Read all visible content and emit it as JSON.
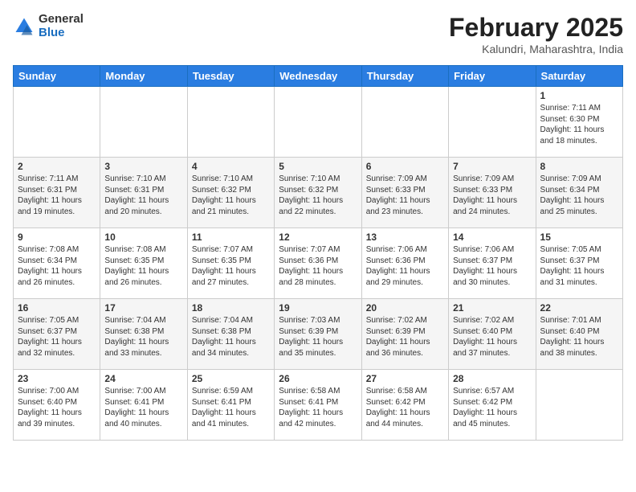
{
  "logo": {
    "general": "General",
    "blue": "Blue"
  },
  "title": "February 2025",
  "subtitle": "Kalundri, Maharashtra, India",
  "days_of_week": [
    "Sunday",
    "Monday",
    "Tuesday",
    "Wednesday",
    "Thursday",
    "Friday",
    "Saturday"
  ],
  "weeks": [
    [
      {
        "day": "",
        "info": ""
      },
      {
        "day": "",
        "info": ""
      },
      {
        "day": "",
        "info": ""
      },
      {
        "day": "",
        "info": ""
      },
      {
        "day": "",
        "info": ""
      },
      {
        "day": "",
        "info": ""
      },
      {
        "day": "1",
        "info": "Sunrise: 7:11 AM\nSunset: 6:30 PM\nDaylight: 11 hours\nand 18 minutes."
      }
    ],
    [
      {
        "day": "2",
        "info": "Sunrise: 7:11 AM\nSunset: 6:31 PM\nDaylight: 11 hours\nand 19 minutes."
      },
      {
        "day": "3",
        "info": "Sunrise: 7:10 AM\nSunset: 6:31 PM\nDaylight: 11 hours\nand 20 minutes."
      },
      {
        "day": "4",
        "info": "Sunrise: 7:10 AM\nSunset: 6:32 PM\nDaylight: 11 hours\nand 21 minutes."
      },
      {
        "day": "5",
        "info": "Sunrise: 7:10 AM\nSunset: 6:32 PM\nDaylight: 11 hours\nand 22 minutes."
      },
      {
        "day": "6",
        "info": "Sunrise: 7:09 AM\nSunset: 6:33 PM\nDaylight: 11 hours\nand 23 minutes."
      },
      {
        "day": "7",
        "info": "Sunrise: 7:09 AM\nSunset: 6:33 PM\nDaylight: 11 hours\nand 24 minutes."
      },
      {
        "day": "8",
        "info": "Sunrise: 7:09 AM\nSunset: 6:34 PM\nDaylight: 11 hours\nand 25 minutes."
      }
    ],
    [
      {
        "day": "9",
        "info": "Sunrise: 7:08 AM\nSunset: 6:34 PM\nDaylight: 11 hours\nand 26 minutes."
      },
      {
        "day": "10",
        "info": "Sunrise: 7:08 AM\nSunset: 6:35 PM\nDaylight: 11 hours\nand 26 minutes."
      },
      {
        "day": "11",
        "info": "Sunrise: 7:07 AM\nSunset: 6:35 PM\nDaylight: 11 hours\nand 27 minutes."
      },
      {
        "day": "12",
        "info": "Sunrise: 7:07 AM\nSunset: 6:36 PM\nDaylight: 11 hours\nand 28 minutes."
      },
      {
        "day": "13",
        "info": "Sunrise: 7:06 AM\nSunset: 6:36 PM\nDaylight: 11 hours\nand 29 minutes."
      },
      {
        "day": "14",
        "info": "Sunrise: 7:06 AM\nSunset: 6:37 PM\nDaylight: 11 hours\nand 30 minutes."
      },
      {
        "day": "15",
        "info": "Sunrise: 7:05 AM\nSunset: 6:37 PM\nDaylight: 11 hours\nand 31 minutes."
      }
    ],
    [
      {
        "day": "16",
        "info": "Sunrise: 7:05 AM\nSunset: 6:37 PM\nDaylight: 11 hours\nand 32 minutes."
      },
      {
        "day": "17",
        "info": "Sunrise: 7:04 AM\nSunset: 6:38 PM\nDaylight: 11 hours\nand 33 minutes."
      },
      {
        "day": "18",
        "info": "Sunrise: 7:04 AM\nSunset: 6:38 PM\nDaylight: 11 hours\nand 34 minutes."
      },
      {
        "day": "19",
        "info": "Sunrise: 7:03 AM\nSunset: 6:39 PM\nDaylight: 11 hours\nand 35 minutes."
      },
      {
        "day": "20",
        "info": "Sunrise: 7:02 AM\nSunset: 6:39 PM\nDaylight: 11 hours\nand 36 minutes."
      },
      {
        "day": "21",
        "info": "Sunrise: 7:02 AM\nSunset: 6:40 PM\nDaylight: 11 hours\nand 37 minutes."
      },
      {
        "day": "22",
        "info": "Sunrise: 7:01 AM\nSunset: 6:40 PM\nDaylight: 11 hours\nand 38 minutes."
      }
    ],
    [
      {
        "day": "23",
        "info": "Sunrise: 7:00 AM\nSunset: 6:40 PM\nDaylight: 11 hours\nand 39 minutes."
      },
      {
        "day": "24",
        "info": "Sunrise: 7:00 AM\nSunset: 6:41 PM\nDaylight: 11 hours\nand 40 minutes."
      },
      {
        "day": "25",
        "info": "Sunrise: 6:59 AM\nSunset: 6:41 PM\nDaylight: 11 hours\nand 41 minutes."
      },
      {
        "day": "26",
        "info": "Sunrise: 6:58 AM\nSunset: 6:41 PM\nDaylight: 11 hours\nand 42 minutes."
      },
      {
        "day": "27",
        "info": "Sunrise: 6:58 AM\nSunset: 6:42 PM\nDaylight: 11 hours\nand 44 minutes."
      },
      {
        "day": "28",
        "info": "Sunrise: 6:57 AM\nSunset: 6:42 PM\nDaylight: 11 hours\nand 45 minutes."
      },
      {
        "day": "",
        "info": ""
      }
    ]
  ]
}
